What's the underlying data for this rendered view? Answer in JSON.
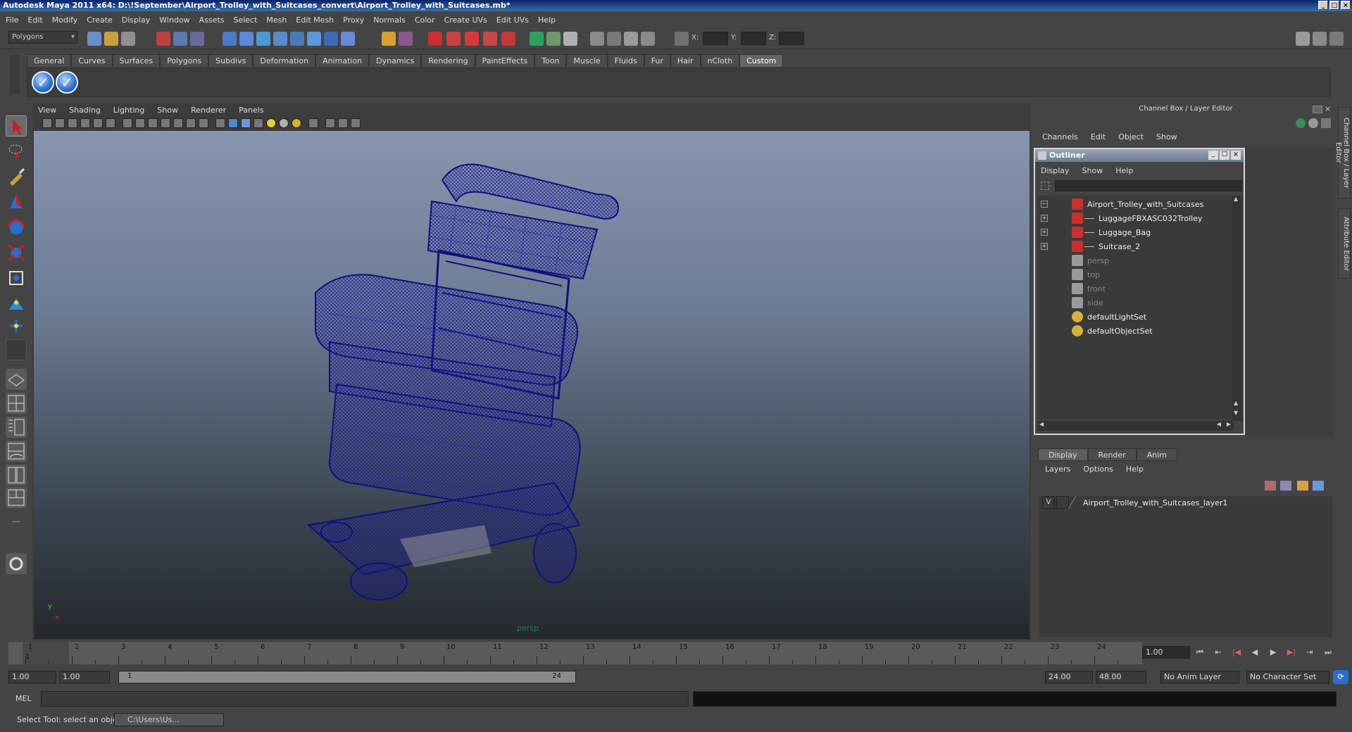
{
  "window": {
    "title": "Autodesk Maya 2011 x64: D:\\!September\\Airport_Trolley_with_Suitcases_convert\\Airport_Trolley_with_Suitcases.mb*",
    "buttons": [
      "_",
      "□",
      "×"
    ]
  },
  "menubar": [
    "File",
    "Edit",
    "Modify",
    "Create",
    "Display",
    "Window",
    "Assets",
    "Select",
    "Mesh",
    "Edit Mesh",
    "Proxy",
    "Normals",
    "Color",
    "Create UVs",
    "Edit UVs",
    "Help"
  ],
  "statusline": {
    "mode": "Polygons",
    "coord_labels": [
      "X:",
      "Y:",
      "Z:"
    ]
  },
  "shelf": {
    "tabs": [
      "General",
      "Curves",
      "Surfaces",
      "Polygons",
      "Subdivs",
      "Deformation",
      "Animation",
      "Dynamics",
      "Rendering",
      "PaintEffects",
      "Toon",
      "Muscle",
      "Fluids",
      "Fur",
      "Hair",
      "nCloth",
      "Custom"
    ],
    "active_tab": "Custom",
    "icons": [
      "check-icon",
      "check-icon"
    ]
  },
  "viewport": {
    "menu": [
      "View",
      "Shading",
      "Lighting",
      "Show",
      "Renderer",
      "Panels"
    ],
    "camera_label": "persp",
    "axis_y": "y",
    "axis_x": "x",
    "wire_color": "#1a1a7a"
  },
  "channelbox": {
    "title": "Channel Box / Layer Editor",
    "menu": [
      "Channels",
      "Edit",
      "Object",
      "Show"
    ]
  },
  "outliner": {
    "title": "Outliner",
    "menu": [
      "Display",
      "Show",
      "Help"
    ],
    "items": [
      {
        "label": "Airport_Trolley_with_Suitcases",
        "expander": "−",
        "type": "transform",
        "indent": 0,
        "dim": false
      },
      {
        "label": "LuggageFBXASC032Trolley",
        "expander": "+",
        "type": "transform",
        "indent": 1,
        "dim": false
      },
      {
        "label": "Luggage_Bag",
        "expander": "+",
        "type": "transform",
        "indent": 1,
        "dim": false
      },
      {
        "label": "Suitcase_2",
        "expander": "+",
        "type": "transform",
        "indent": 1,
        "dim": false
      },
      {
        "label": "persp",
        "expander": "",
        "type": "camera",
        "indent": 0,
        "dim": true
      },
      {
        "label": "top",
        "expander": "",
        "type": "camera",
        "indent": 0,
        "dim": true
      },
      {
        "label": "front",
        "expander": "",
        "type": "camera",
        "indent": 0,
        "dim": true
      },
      {
        "label": "side",
        "expander": "",
        "type": "camera",
        "indent": 0,
        "dim": true
      },
      {
        "label": "defaultLightSet",
        "expander": "",
        "type": "set",
        "indent": 0,
        "dim": false
      },
      {
        "label": "defaultObjectSet",
        "expander": "",
        "type": "set",
        "indent": 0,
        "dim": false
      }
    ]
  },
  "layers": {
    "tabs": [
      "Display",
      "Render",
      "Anim"
    ],
    "active_tab": "Display",
    "menu": [
      "Layers",
      "Options",
      "Help"
    ],
    "rows": [
      {
        "visible": "V",
        "name": "Airport_Trolley_with_Suitcases_layer1"
      }
    ]
  },
  "timeline": {
    "ticks": [
      "1",
      "2",
      "3",
      "4",
      "5",
      "6",
      "7",
      "8",
      "9",
      "10",
      "11",
      "12",
      "13",
      "14",
      "15",
      "16",
      "17",
      "18",
      "19",
      "20",
      "21",
      "22",
      "23",
      "24"
    ],
    "current_marker": "1",
    "current_frame": "1.00",
    "playback_buttons": [
      "⏮",
      "⇤",
      "|◀",
      "◀",
      "▶",
      "▶|",
      "⇥",
      "⏭"
    ]
  },
  "range": {
    "start": "1.00",
    "playback_start": "1.00",
    "slider_start": "1",
    "slider_end": "24",
    "playback_end": "24.00",
    "end": "48.00",
    "anim_layer": "No Anim Layer",
    "character_set": "No Character Set"
  },
  "cmdline": {
    "label": "MEL"
  },
  "helpline": {
    "text": "Select Tool: select an object",
    "task": "C:\\Users\\Us..."
  },
  "side_tabs": [
    "Channel Box / Layer Editor",
    "Attribute Editor"
  ]
}
